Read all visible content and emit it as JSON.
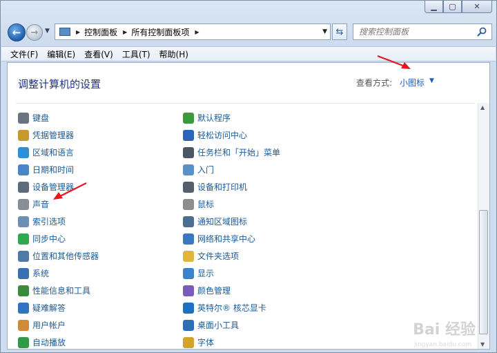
{
  "nav": {
    "breadcrumbs": [
      "控制面板",
      "所有控制面板项"
    ],
    "search_placeholder": "搜索控制面板"
  },
  "menu": [
    "文件(F)",
    "编辑(E)",
    "查看(V)",
    "工具(T)",
    "帮助(H)"
  ],
  "page": {
    "title": "调整计算机的设置",
    "view_by_label": "查看方式:",
    "view_by_value": "小图标"
  },
  "items_left": [
    {
      "label": "键盘",
      "icon": "keyboard-icon",
      "color": "#6b7280"
    },
    {
      "label": "凭据管理器",
      "icon": "vault-icon",
      "color": "#c79a2e"
    },
    {
      "label": "区域和语言",
      "icon": "globe-icon",
      "color": "#2f8fd6"
    },
    {
      "label": "日期和时间",
      "icon": "calendar-icon",
      "color": "#4a86c7"
    },
    {
      "label": "设备管理器",
      "icon": "printer-device-icon",
      "color": "#5f6b78"
    },
    {
      "label": "声音",
      "icon": "speaker-icon",
      "color": "#8a8f96"
    },
    {
      "label": "索引选项",
      "icon": "magnifier-icon",
      "color": "#6f8fb0"
    },
    {
      "label": "同步中心",
      "icon": "sync-icon",
      "color": "#2fa84f"
    },
    {
      "label": "位置和其他传感器",
      "icon": "sensor-icon",
      "color": "#4f7aa8"
    },
    {
      "label": "系统",
      "icon": "computer-icon",
      "color": "#3a6fb0"
    },
    {
      "label": "性能信息和工具",
      "icon": "performance-icon",
      "color": "#3c8a3c"
    },
    {
      "label": "疑难解答",
      "icon": "troubleshoot-icon",
      "color": "#2e74c0"
    },
    {
      "label": "用户帐户",
      "icon": "users-icon",
      "color": "#d08a3a"
    },
    {
      "label": "自动播放",
      "icon": "autoplay-icon",
      "color": "#2f9a45"
    }
  ],
  "items_right": [
    {
      "label": "默认程序",
      "icon": "default-programs-icon",
      "color": "#3b9a3b"
    },
    {
      "label": "轻松访问中心",
      "icon": "accessibility-icon",
      "color": "#2b64b8"
    },
    {
      "label": "任务栏和「开始」菜单",
      "icon": "taskbar-icon",
      "color": "#4b5563"
    },
    {
      "label": "入门",
      "icon": "getting-started-icon",
      "color": "#5a8fc7"
    },
    {
      "label": "设备和打印机",
      "icon": "printer-icon",
      "color": "#555e69"
    },
    {
      "label": "鼠标",
      "icon": "mouse-icon",
      "color": "#8e8e8e"
    },
    {
      "label": "通知区域图标",
      "icon": "notification-icon",
      "color": "#4e6d92"
    },
    {
      "label": "网络和共享中心",
      "icon": "network-icon",
      "color": "#3a79bf"
    },
    {
      "label": "文件夹选项",
      "icon": "folder-icon",
      "color": "#e0b43d"
    },
    {
      "label": "显示",
      "icon": "display-icon",
      "color": "#3a83c9"
    },
    {
      "label": "颜色管理",
      "icon": "color-management-icon",
      "color": "#7a5cb8"
    },
    {
      "label": "英特尔® 核芯显卡",
      "icon": "intel-graphics-icon",
      "color": "#1f6fc1"
    },
    {
      "label": "桌面小工具",
      "icon": "gadgets-icon",
      "color": "#2f6eb4"
    },
    {
      "label": "字体",
      "icon": "fonts-icon",
      "color": "#d5a32b"
    }
  ],
  "watermark": {
    "brand": "Bai 经验",
    "url": "jingyan.baidu.com"
  }
}
